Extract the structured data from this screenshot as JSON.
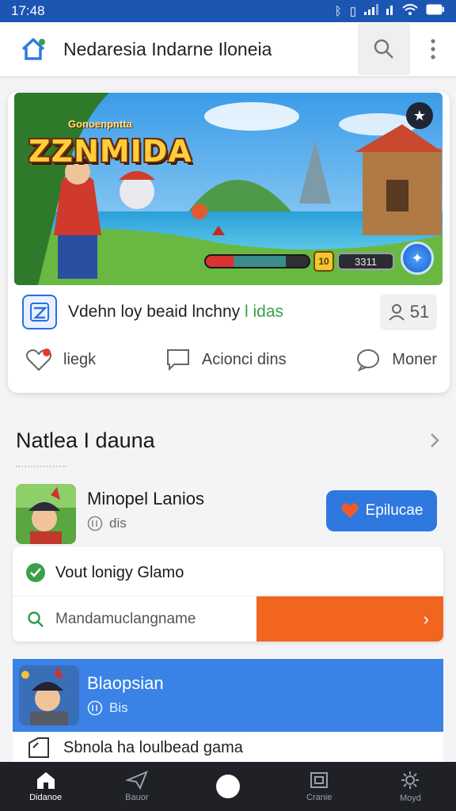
{
  "status": {
    "time": "17:48"
  },
  "appbar": {
    "title": "Nedaresia Indarne Iloneia"
  },
  "card": {
    "game_logo_sub": "Gonoenpntta",
    "game_logo": "ZZNMIDA",
    "hud_coin": "10",
    "hud_score": "3311",
    "title_main": "Vdehn loy beaid lnchny",
    "title_accent": "l idas",
    "user_count": "51",
    "actions": [
      {
        "label": "liegk"
      },
      {
        "label": "Acionci dins"
      },
      {
        "label": "Moner"
      }
    ]
  },
  "section": {
    "title": "Natlea I dauna"
  },
  "item": {
    "title": "Minopel Lanios",
    "meta": "ӏ̈ı dis",
    "meta_icon": "II",
    "button_label": "Epilucae"
  },
  "panel": {
    "row_title": "Vout lonigy Glamo",
    "search_text": "Mandamuclangname",
    "go": "›"
  },
  "featured": {
    "title": "Blaopsian",
    "meta_icon": "II",
    "meta": "Bis",
    "row2": "Sbnola ha loulbead gama"
  },
  "nav": [
    {
      "label": "Didanoe",
      "icon": "home-icon"
    },
    {
      "label": "Bauor",
      "icon": "paper-plane-icon"
    },
    {
      "label": "",
      "icon": "center-dot"
    },
    {
      "label": "Cranie",
      "icon": "box-icon"
    },
    {
      "label": "Moyd",
      "icon": "gear-icon"
    }
  ],
  "colors": {
    "primary": "#1d55b3",
    "accent_blue": "#2f78e0",
    "orange": "#f2651f",
    "green": "#3aa04a"
  }
}
